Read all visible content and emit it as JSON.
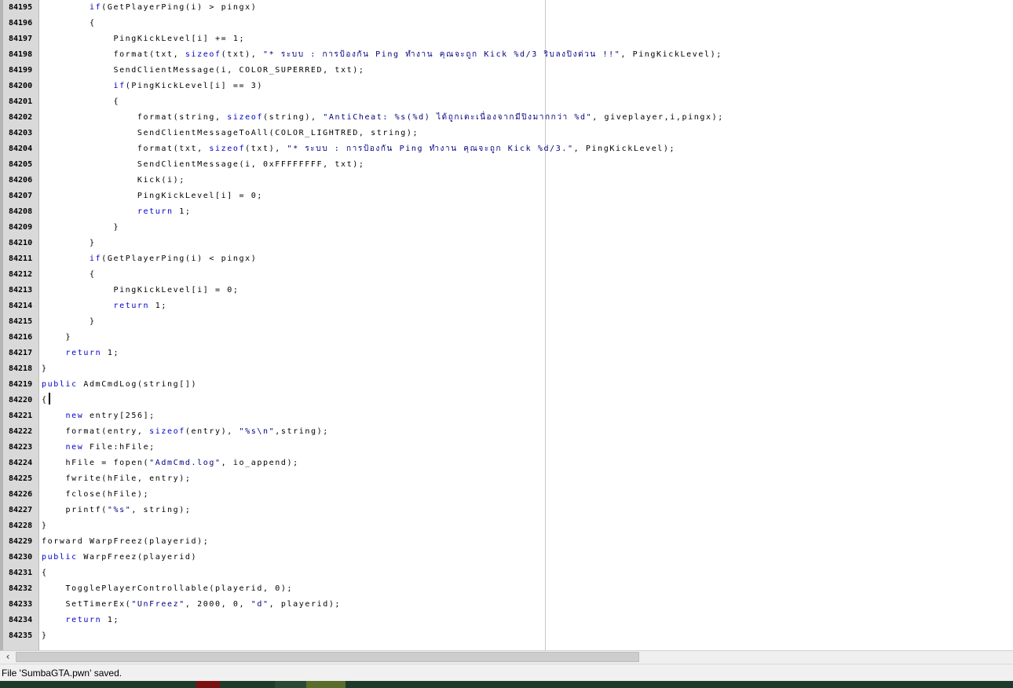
{
  "editor": {
    "lines": [
      {
        "n": "84195",
        "html": "        <span class=\"kw\">if</span>(GetPlayerPing(i) &gt; pingx)"
      },
      {
        "n": "84196",
        "html": "        {"
      },
      {
        "n": "84197",
        "html": "            PingKickLevel[i] += 1;"
      },
      {
        "n": "84198",
        "html": "            format(txt, <span class=\"kw\">sizeof</span>(txt), <span class=\"str\">\"* ระบบ : การป้องกัน Ping ทำงาน คุณจะถูก Kick %d/3 ริบลงปิงด่วน !!\"</span>, PingKickLevel);"
      },
      {
        "n": "84199",
        "html": "            SendClientMessage(i, COLOR_SUPERRED, txt);"
      },
      {
        "n": "84200",
        "html": "            <span class=\"kw\">if</span>(PingKickLevel[i] == 3)"
      },
      {
        "n": "84201",
        "html": "            {"
      },
      {
        "n": "84202",
        "html": "                format(string, <span class=\"kw\">sizeof</span>(string), <span class=\"str\">\"AntiCheat: %s(%d) ได้ถูกเตะเนื่องจากมีปิงมากกว่า %d\"</span>, giveplayer,i,pingx);"
      },
      {
        "n": "84203",
        "html": "                SendClientMessageToAll(COLOR_LIGHTRED, string);"
      },
      {
        "n": "84204",
        "html": "                format(txt, <span class=\"kw\">sizeof</span>(txt), <span class=\"str\">\"* ระบบ : การป้องกัน Ping ทำงาน คุณจะถูก Kick %d/3.\"</span>, PingKickLevel);"
      },
      {
        "n": "84205",
        "html": "                SendClientMessage(i, 0xFFFFFFFF, txt);"
      },
      {
        "n": "84206",
        "html": "                Kick(i);"
      },
      {
        "n": "84207",
        "html": "                PingKickLevel[i] = 0;"
      },
      {
        "n": "84208",
        "html": "                <span class=\"kw\">return</span> 1;"
      },
      {
        "n": "84209",
        "html": "            }"
      },
      {
        "n": "84210",
        "html": "        }"
      },
      {
        "n": "84211",
        "html": "        <span class=\"kw\">if</span>(GetPlayerPing(i) &lt; pingx)"
      },
      {
        "n": "84212",
        "html": "        {"
      },
      {
        "n": "84213",
        "html": "            PingKickLevel[i] = 0;"
      },
      {
        "n": "84214",
        "html": "            <span class=\"kw\">return</span> 1;"
      },
      {
        "n": "84215",
        "html": "        }"
      },
      {
        "n": "84216",
        "html": "    }"
      },
      {
        "n": "84217",
        "html": "    <span class=\"kw\">return</span> 1;"
      },
      {
        "n": "84218",
        "html": "}"
      },
      {
        "n": "84219",
        "html": "<span class=\"kw\">public</span> AdmCmdLog(string[])"
      },
      {
        "n": "84220",
        "html": "{<span class=\"caret\" data-name=\"text-caret\"></span>"
      },
      {
        "n": "84221",
        "html": "    <span class=\"kw\">new</span> entry[256];"
      },
      {
        "n": "84222",
        "html": "    format(entry, <span class=\"kw\">sizeof</span>(entry), <span class=\"str\">\"%s\\n\"</span>,string);"
      },
      {
        "n": "84223",
        "html": "    <span class=\"kw\">new</span> File:hFile;"
      },
      {
        "n": "84224",
        "html": "    hFile = fopen(<span class=\"str\">\"AdmCmd.log\"</span>, io_append);"
      },
      {
        "n": "84225",
        "html": "    fwrite(hFile, entry);"
      },
      {
        "n": "84226",
        "html": "    fclose(hFile);"
      },
      {
        "n": "84227",
        "html": "    printf(<span class=\"str\">\"%s\"</span>, string);"
      },
      {
        "n": "84228",
        "html": "}"
      },
      {
        "n": "84229",
        "html": "forward WarpFreez(playerid);"
      },
      {
        "n": "84230",
        "html": "<span class=\"kw\">public</span> WarpFreez(playerid)"
      },
      {
        "n": "84231",
        "html": "{"
      },
      {
        "n": "84232",
        "html": "    TogglePlayerControllable(playerid, 0);"
      },
      {
        "n": "84233",
        "html": "    SetTimerEx(<span class=\"str\">\"UnFreez\"</span>, 2000, 0, <span class=\"str\">\"d\"</span>, playerid);"
      },
      {
        "n": "84234",
        "html": "    <span class=\"kw\">return</span> 1;"
      },
      {
        "n": "84235",
        "html": "}"
      }
    ]
  },
  "scrollbar": {
    "left_arrow": "‹"
  },
  "status": {
    "message": "File 'SumbaGTA.pwn' saved."
  },
  "colors": {
    "keyword": "#0000c8",
    "string": "#000080",
    "gutter": "#d9d9d9"
  },
  "taskbar": {
    "segments": [
      {
        "color": "#1d3a2a"
      },
      {
        "color": "#7a1010"
      },
      {
        "color": "#2b4a36"
      },
      {
        "color": "#5a6d2a"
      }
    ]
  }
}
